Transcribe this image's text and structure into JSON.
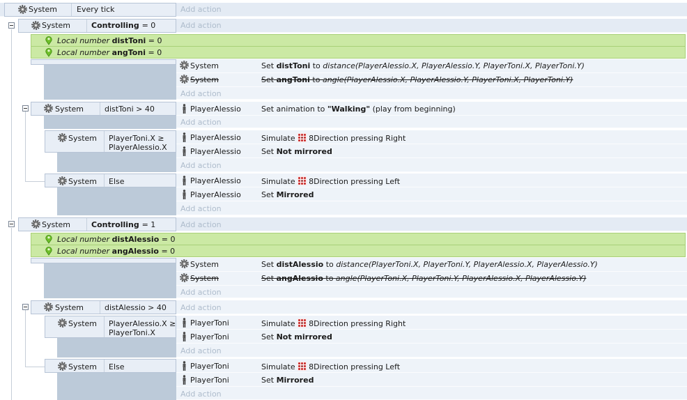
{
  "ui": {
    "add_action": "Add action"
  },
  "events": [
    {
      "obj": "System",
      "cond": "Every tick"
    },
    {
      "obj": "System",
      "cond_prefix": "Controlling ",
      "cond_op": "= 0"
    },
    {
      "locals": [
        {
          "label": "Local number",
          "name": "distToni",
          "value": "= 0"
        },
        {
          "label": "Local number",
          "name": "angToni",
          "value": "= 0"
        }
      ]
    },
    {
      "actions": [
        {
          "obj": "System",
          "verb": "Set",
          "var": "distToni",
          "to": "to",
          "func": "distance(PlayerAlessio.X, PlayerAlessio.Y, PlayerToni.X, PlayerToni.Y)",
          "disabled": false
        },
        {
          "obj": "System",
          "verb": "Set",
          "var": "angToni",
          "to": "to",
          "func": "angle(PlayerAlessio.X, PlayerAlessio.Y, PlayerToni.X, PlayerToni.Y)",
          "disabled": true
        }
      ]
    },
    {
      "obj": "System",
      "cond": "distToni > 40",
      "actions": [
        {
          "obj": "PlayerAlessio",
          "text1": "Set animation to ",
          "quoted": "\"Walking\"",
          "text2": " (play from beginning)"
        }
      ]
    },
    {
      "obj": "System",
      "cond_lines": [
        "PlayerToni.X ≥",
        "PlayerAlessio.X"
      ],
      "actions": [
        {
          "obj": "PlayerAlessio",
          "text1": "Simulate ",
          "behavior": "8Direction",
          "text2": " pressing Right"
        },
        {
          "obj": "PlayerAlessio",
          "text1": "Set ",
          "bold": "Not mirrored"
        }
      ]
    },
    {
      "obj": "System",
      "cond": "Else",
      "actions": [
        {
          "obj": "PlayerAlessio",
          "text1": "Simulate ",
          "behavior": "8Direction",
          "text2": " pressing Left"
        },
        {
          "obj": "PlayerAlessio",
          "text1": "Set ",
          "bold": "Mirrored"
        }
      ]
    },
    {
      "obj": "System",
      "cond_prefix": "Controlling ",
      "cond_op": "= 1"
    },
    {
      "locals": [
        {
          "label": "Local number",
          "name": "distAlessio",
          "value": "= 0"
        },
        {
          "label": "Local number",
          "name": "angAlessio",
          "value": "= 0"
        }
      ]
    },
    {
      "actions": [
        {
          "obj": "System",
          "verb": "Set",
          "var": "distAlessio",
          "to": "to",
          "func": "distance(PlayerToni.X, PlayerToni.Y, PlayerAlessio.X, PlayerAlessio.Y)",
          "disabled": false
        },
        {
          "obj": "System",
          "verb": "Set",
          "var": "angAlessio",
          "to": "to",
          "func": "angle(PlayerToni.X, PlayerToni.Y, PlayerAlessio.X, PlayerAlessio.Y)",
          "disabled": true
        }
      ]
    },
    {
      "obj": "System",
      "cond": "distAlessio > 40"
    },
    {
      "obj": "System",
      "cond_lines": [
        "PlayerAlessio.X ≥",
        "PlayerToni.X"
      ],
      "actions": [
        {
          "obj": "PlayerToni",
          "text1": "Simulate ",
          "behavior": "8Direction",
          "text2": " pressing Right"
        },
        {
          "obj": "PlayerToni",
          "text1": "Set ",
          "bold": "Not mirrored"
        }
      ]
    },
    {
      "obj": "System",
      "cond": "Else",
      "actions": [
        {
          "obj": "PlayerToni",
          "text1": "Simulate ",
          "behavior": "8Direction",
          "text2": " pressing Left"
        },
        {
          "obj": "PlayerToni",
          "text1": "Set ",
          "bold": "Mirrored"
        }
      ]
    }
  ]
}
